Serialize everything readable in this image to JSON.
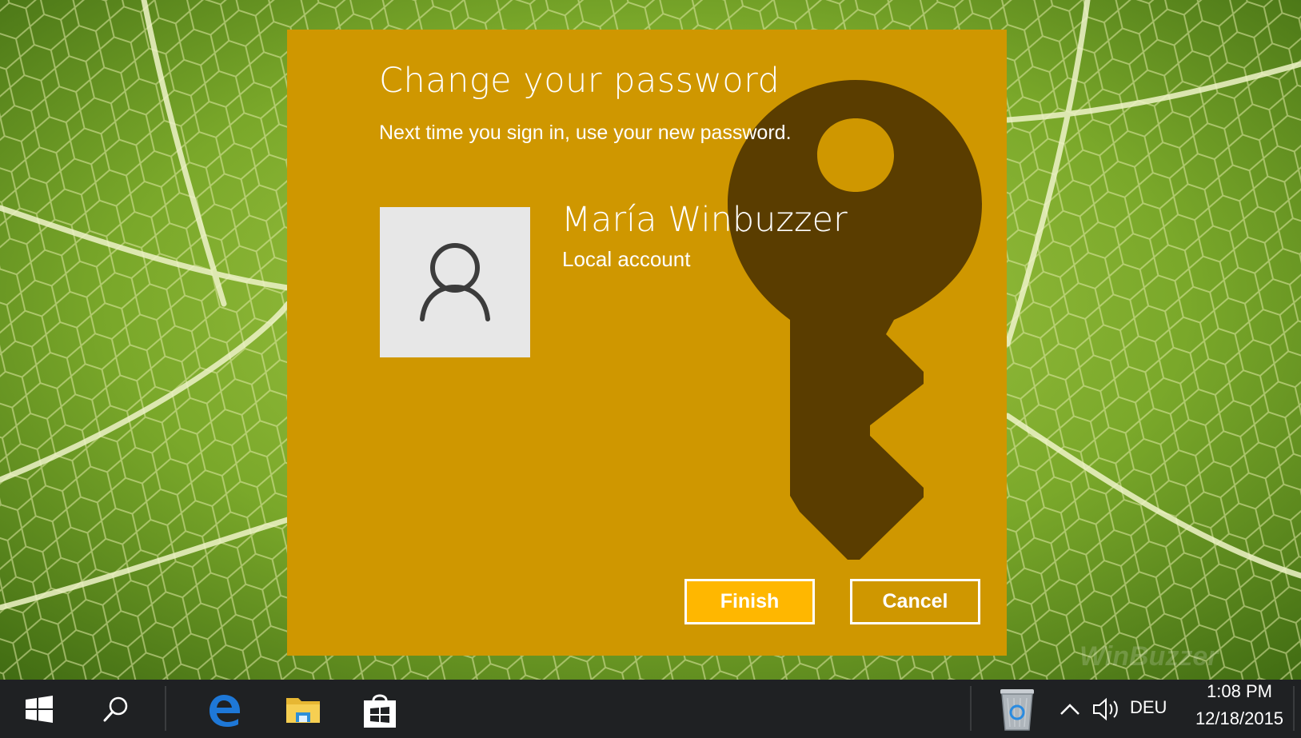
{
  "dialog": {
    "title": "Change your password",
    "subtitle": "Next time you sign in, use your new password.",
    "user_name": "María Winbuzzer",
    "account_type": "Local account",
    "finish_label": "Finish",
    "cancel_label": "Cancel"
  },
  "watermark": "WinBuzzer",
  "taskbar": {
    "pinned": [
      "start-icon",
      "search-icon",
      "edge-icon",
      "file-explorer-icon",
      "store-icon"
    ],
    "tray_icons": [
      "recycle-bin-icon",
      "chevron-up-icon",
      "volume-icon"
    ],
    "language": "DEU",
    "time": "1:08 PM",
    "date": "12/18/2015"
  },
  "colors": {
    "dialog_bg": "#cf9700",
    "finish_bg": "#ffb700",
    "key_art": "#4a3100",
    "taskbar_bg": "#1f2123",
    "edge_blue": "#1e78d7"
  }
}
